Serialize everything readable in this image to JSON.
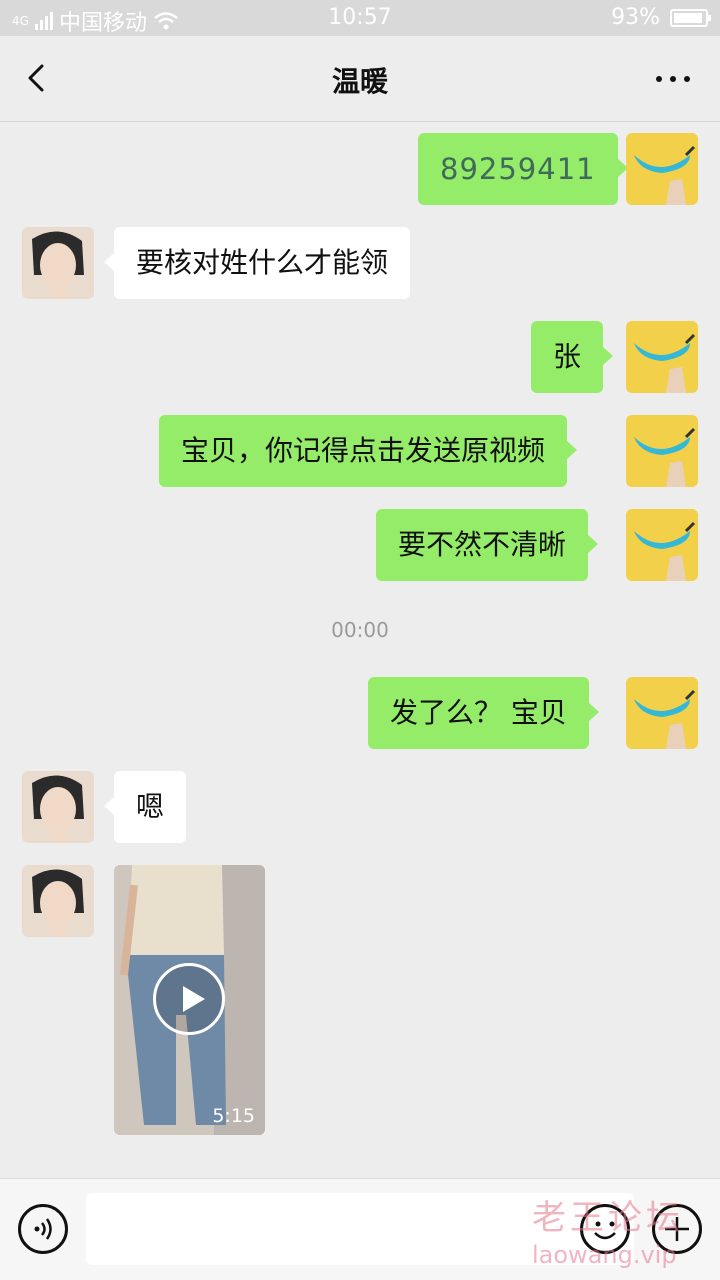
{
  "status_bar": {
    "network": "4G",
    "carrier": "中国移动",
    "time": "10:57",
    "battery": "93%"
  },
  "chat": {
    "title": "温暖"
  },
  "messages": [
    {
      "side": "out",
      "text": "89259411"
    },
    {
      "side": "in",
      "text": "要核对姓什么才能领"
    },
    {
      "side": "out",
      "text": "张"
    },
    {
      "side": "out",
      "text": "宝贝，你记得点击发送原视频"
    },
    {
      "side": "out",
      "text": "要不然不清晰"
    },
    {
      "type": "timestamp",
      "text": "00:00"
    },
    {
      "side": "out",
      "text": "发了么？ 宝贝"
    },
    {
      "side": "in",
      "text": "嗯"
    },
    {
      "side": "in",
      "type": "video",
      "duration": "5:15"
    }
  ],
  "input_bar": {
    "value": "",
    "placeholder": ""
  },
  "watermark": {
    "line1": "老王论坛",
    "line2": "laowang.vip"
  },
  "colors": {
    "bubble_out": "#95ec69",
    "bubble_in": "#ffffff",
    "background": "#ededed",
    "avatar_me": "#f2d04a"
  }
}
